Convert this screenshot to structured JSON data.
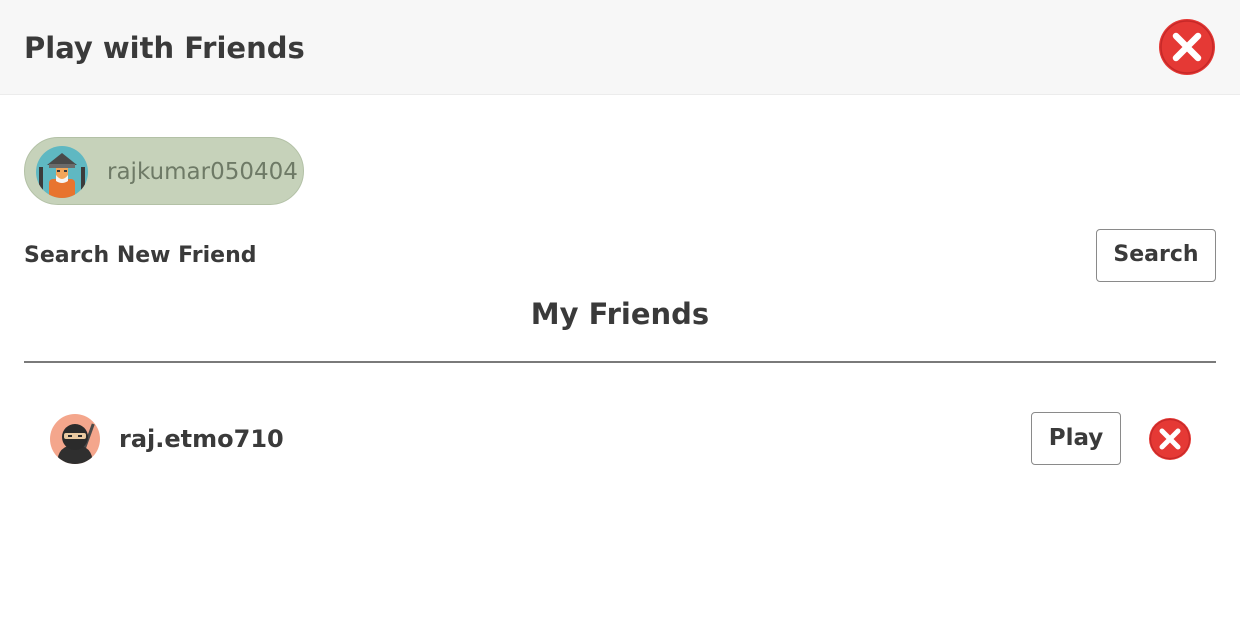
{
  "header": {
    "title": "Play with Friends",
    "close_icon": "close-circle-icon"
  },
  "current_user": {
    "username": "rajkumar050404",
    "avatar_icon": "samurai-avatar-icon"
  },
  "search": {
    "label": "Search New Friend",
    "button_label": "Search"
  },
  "friends": {
    "title": "My Friends",
    "items": [
      {
        "name": "raj.etmo710",
        "avatar_icon": "ninja-avatar-icon",
        "play_label": "Play",
        "remove_icon": "remove-circle-icon"
      }
    ]
  },
  "colors": {
    "close_red": "#e53935",
    "chip_background": "#c6d2ba",
    "header_background": "#f7f7f7"
  }
}
